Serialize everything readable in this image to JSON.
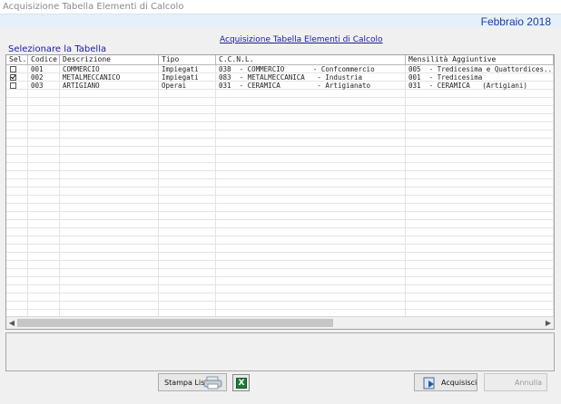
{
  "window": {
    "title": "Acquisizione Tabella Elementi di Calcolo"
  },
  "header": {
    "period": "Febbraio 2018"
  },
  "page_link": "Acquisizione Tabella Elementi di Calcolo",
  "section_label": "Selezionare la Tabella",
  "grid": {
    "columns": [
      "Sel.",
      "Codice",
      "Descrizione",
      "Tipo",
      "C.C.N.L.",
      "Mensilità Aggiuntive"
    ],
    "rows": [
      {
        "selected": false,
        "codice": "001",
        "descrizione": "COMMERCIO",
        "tipo": "Impiegati",
        "ccnl": "038  - COMMERCIO       - Confcommercio",
        "mensilita": "005  - Tredicesima e Quattordices..."
      },
      {
        "selected": true,
        "codice": "002",
        "descrizione": "METALMECCANICO",
        "tipo": "Impiegati",
        "ccnl": "083  - METALMECCANICA   - Industria",
        "mensilita": "001  - Tredicesima"
      },
      {
        "selected": false,
        "codice": "003",
        "descrizione": "ARTIGIANO",
        "tipo": "Operai",
        "ccnl": "031  - CERAMICA         - Artigianato",
        "mensilita": "031  - CERAMICA   (Artigiani)"
      }
    ]
  },
  "buttons": {
    "print_list": "Stampa Lista",
    "excel_icon": "excel-icon",
    "acquire": "Acquisisci",
    "cancel": "Annulla"
  }
}
